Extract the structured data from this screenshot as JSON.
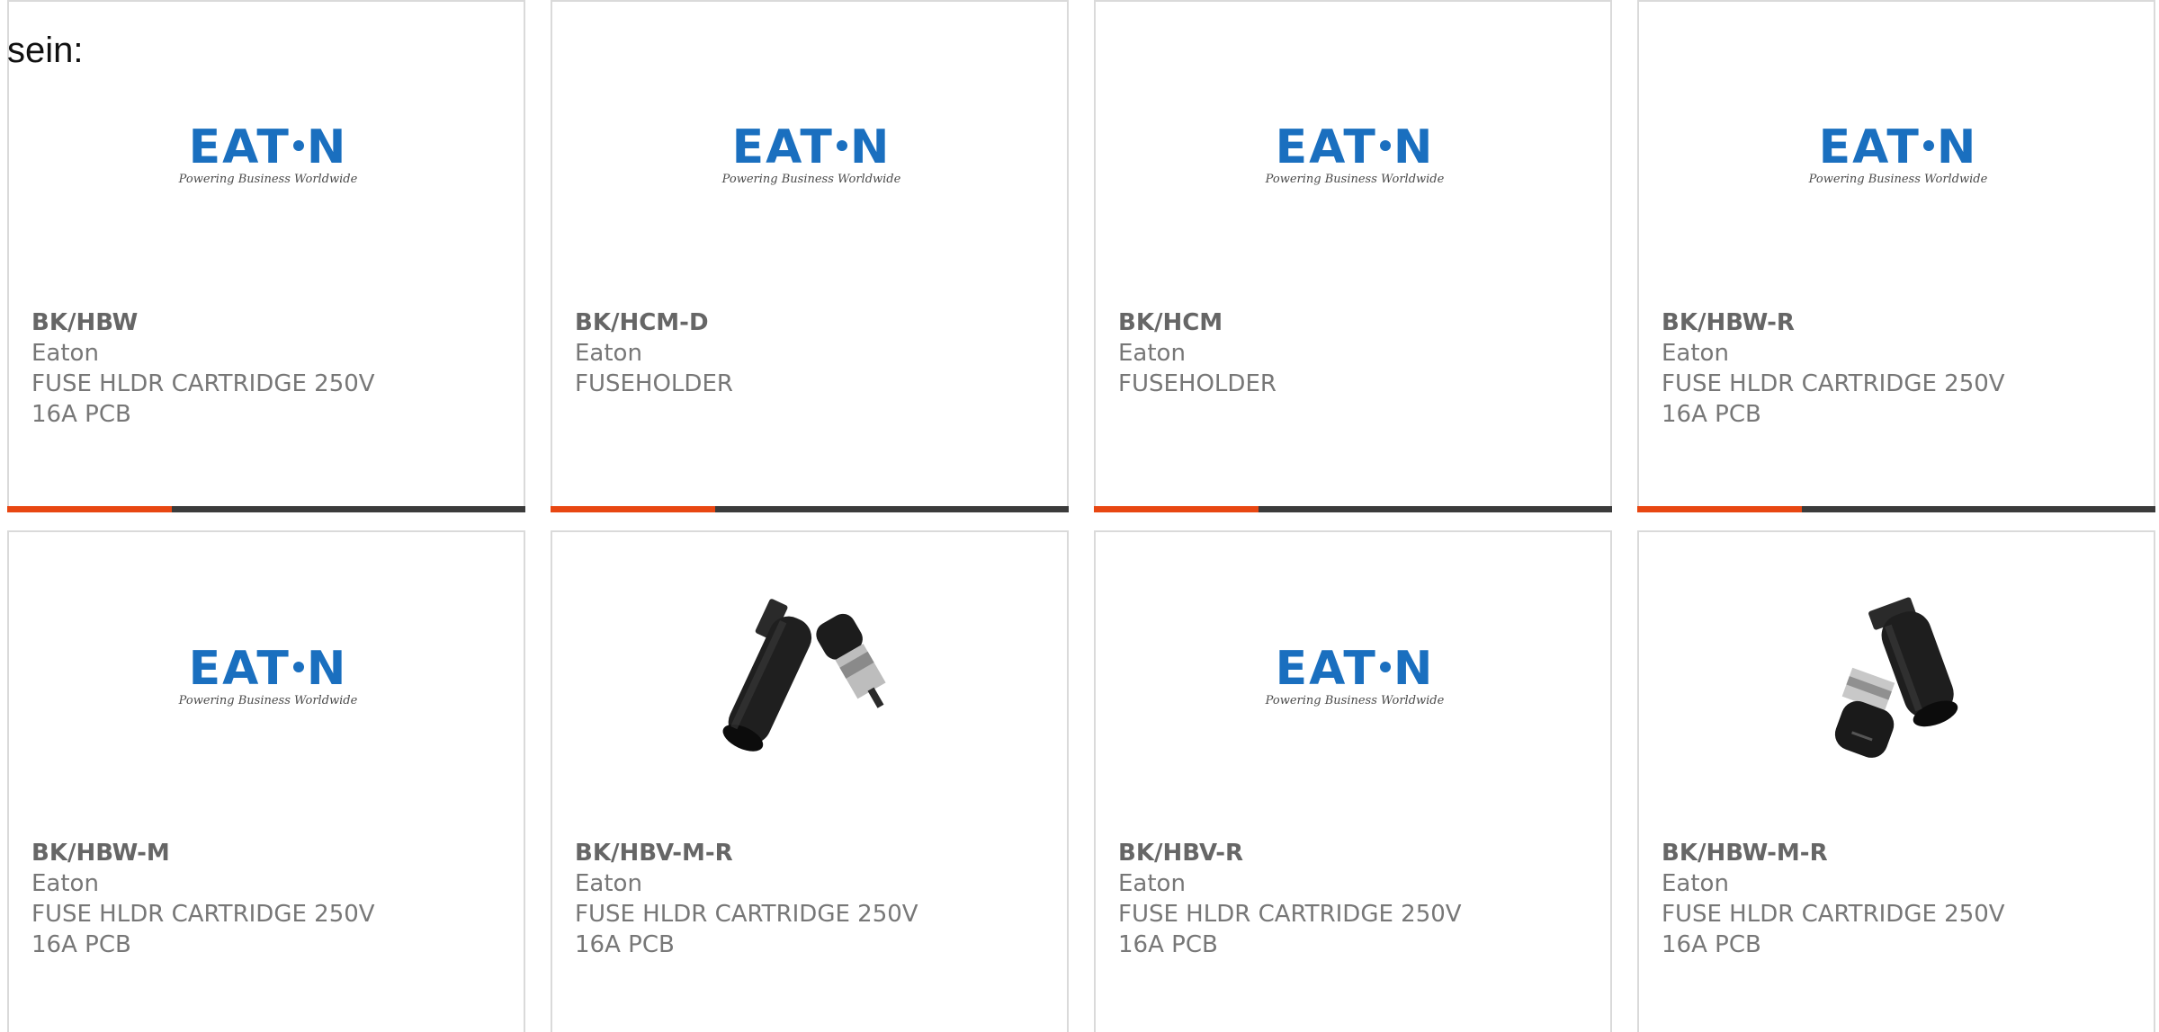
{
  "intro_text": "sein:",
  "logo": {
    "word_left": "E",
    "word_mid": "T",
    "word_right": "N",
    "tagline": "Powering Business Worldwide"
  },
  "colors": {
    "accent": "#e84712",
    "bar": "#3b3b3b",
    "brand": "#1a6fbf"
  },
  "cards": [
    {
      "part": "BK/HBW",
      "manufacturer": "Eaton",
      "description": "FUSE HLDR CARTRIDGE 250V 16A PCB",
      "image": "eaton-logo"
    },
    {
      "part": "BK/HCM-D",
      "manufacturer": "Eaton",
      "description": "FUSEHOLDER",
      "image": "eaton-logo"
    },
    {
      "part": "BK/HCM",
      "manufacturer": "Eaton",
      "description": "FUSEHOLDER",
      "image": "eaton-logo"
    },
    {
      "part": "BK/HBW-R",
      "manufacturer": "Eaton",
      "description": "FUSE HLDR CARTRIDGE 250V 16A PCB",
      "image": "eaton-logo"
    },
    {
      "part": "BK/HBW-M",
      "manufacturer": "Eaton",
      "description": "FUSE HLDR CARTRIDGE 250V 16A PCB",
      "image": "eaton-logo"
    },
    {
      "part": "BK/HBV-M-R",
      "manufacturer": "Eaton",
      "description": "FUSE HLDR CARTRIDGE 250V 16A PCB",
      "image": "fuse-holder-photo-a"
    },
    {
      "part": "BK/HBV-R",
      "manufacturer": "Eaton",
      "description": "FUSE HLDR CARTRIDGE 250V 16A PCB",
      "image": "eaton-logo"
    },
    {
      "part": "BK/HBW-M-R",
      "manufacturer": "Eaton",
      "description": "FUSE HLDR CARTRIDGE 250V 16A PCB",
      "image": "fuse-holder-photo-b"
    }
  ]
}
